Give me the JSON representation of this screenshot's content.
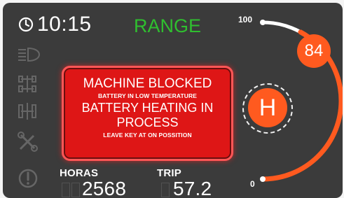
{
  "header": {
    "time": "10:15",
    "mode": "RANGE",
    "clock_icon": "clock-icon"
  },
  "sidebar": {
    "icons": [
      "headlight-icon",
      "axle-icon",
      "axle-alt-icon",
      "tools-icon",
      "warning-icon"
    ]
  },
  "alert": {
    "title": "MACHINE BLOCKED",
    "line_1": "BATTERY IN LOW TEMPERATURE",
    "line_2": "BATTERY HEATING IN",
    "line_3": "PROCESS",
    "line_4": "LEAVE KEY AT ON POSSITION"
  },
  "meters": {
    "horas_label": "HORAS",
    "horas_value": "2568",
    "trip_label": "TRIP",
    "trip_value": "57.2"
  },
  "gauge": {
    "max_label": "100",
    "min_label": "0",
    "value": "84",
    "value_percent": 84,
    "accent": "#ff5a1f",
    "track": "#ffffff"
  },
  "heater": {
    "letter": "H"
  },
  "colors": {
    "screen": "#3b3b3b",
    "mode": "#2fbf2f",
    "alert": "#de1616"
  }
}
